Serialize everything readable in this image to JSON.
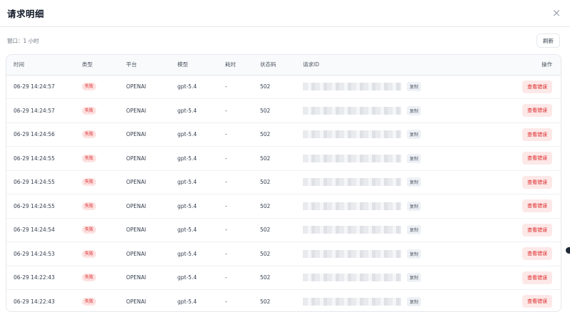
{
  "dialog": {
    "title": "请求明细",
    "close_icon": "×",
    "window_label": "窗口：1 小时",
    "refresh_label": "刷新"
  },
  "table": {
    "headers": {
      "time": "时间",
      "type": "类型",
      "platform": "平台",
      "model": "模型",
      "duration": "耗时",
      "status_code": "状态码",
      "request_id": "请求ID",
      "actions": "操作"
    },
    "copy_label": "复制",
    "error_button_label": "查看错误",
    "rows": [
      {
        "time": "06-29 14:24:57",
        "type": "失败",
        "platform": "OPENAI",
        "model": "gpt-5.4",
        "duration": "-",
        "status_code": "502"
      },
      {
        "time": "06-29 14:24:57",
        "type": "失败",
        "platform": "OPENAI",
        "model": "gpt-5.4",
        "duration": "-",
        "status_code": "502"
      },
      {
        "time": "06-29 14:24:56",
        "type": "失败",
        "platform": "OPENAI",
        "model": "gpt-5.4",
        "duration": "-",
        "status_code": "502"
      },
      {
        "time": "06-29 14:24:55",
        "type": "失败",
        "platform": "OPENAI",
        "model": "gpt-5.4",
        "duration": "-",
        "status_code": "502"
      },
      {
        "time": "06-29 14:24:55",
        "type": "失败",
        "platform": "OPENAI",
        "model": "gpt-5.4",
        "duration": "-",
        "status_code": "502"
      },
      {
        "time": "06-29 14:24:55",
        "type": "失败",
        "platform": "OPENAI",
        "model": "gpt-5.4",
        "duration": "-",
        "status_code": "502"
      },
      {
        "time": "06-29 14:24:54",
        "type": "失败",
        "platform": "OPENAI",
        "model": "gpt-5.4",
        "duration": "-",
        "status_code": "502"
      },
      {
        "time": "06-29 14:24:53",
        "type": "失败",
        "platform": "OPENAI",
        "model": "gpt-5.4",
        "duration": "-",
        "status_code": "502"
      },
      {
        "time": "06-29 14:22:43",
        "type": "失败",
        "platform": "OPENAI",
        "model": "gpt-5.4",
        "duration": "-",
        "status_code": "502"
      },
      {
        "time": "06-29 14:22:43",
        "type": "失败",
        "platform": "OPENAI",
        "model": "gpt-5.4",
        "duration": "-",
        "status_code": "502"
      }
    ]
  },
  "colors": {
    "accent_error": "#dc2626",
    "badge_bg": "#fde2e2",
    "header_bg": "#f9fafb"
  }
}
